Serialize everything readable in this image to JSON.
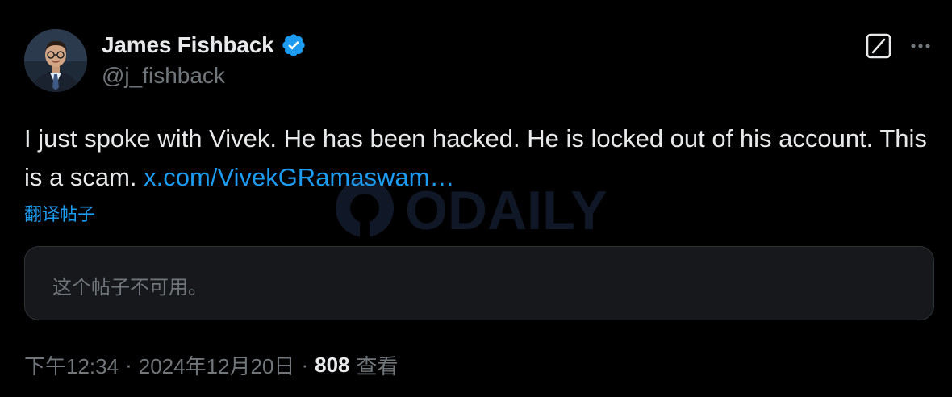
{
  "author": {
    "name": "James Fishback",
    "handle": "@j_fishback"
  },
  "icons": {
    "verified": "verified-badge-icon",
    "grok": "grok-icon",
    "more": "more-options-icon"
  },
  "colors": {
    "background": "#000000",
    "text": "#e7e9ea",
    "secondary": "#71767b",
    "link": "#1d9bf0",
    "card_bg": "#16181c",
    "card_border": "#2f3336"
  },
  "post": {
    "text": "I just spoke with Vivek. He has been hacked. He is locked out of his account. This is a scam. ",
    "link_text": "x.com/VivekGRamaswam…",
    "translate_label": "翻译帖子",
    "quoted_unavailable": "这个帖子不可用。"
  },
  "watermark": {
    "text": "ODAILY"
  },
  "meta": {
    "time": "下午12:34",
    "separator": "·",
    "date": "2024年12月20日",
    "views_count": "808",
    "views_label": "查看"
  }
}
